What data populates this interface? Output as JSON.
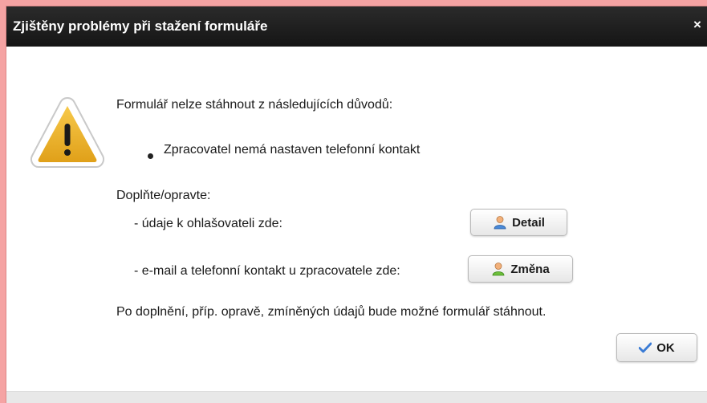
{
  "dialog": {
    "title": "Zjištěny problémy při stažení formuláře",
    "close_glyph": "×",
    "icon": "warning-triangle-icon"
  },
  "message": {
    "intro": "Formulář nelze stáhnout z následujících důvodů:",
    "reasons": [
      "Zpracovatel nemá nastaven telefonní kontakt"
    ],
    "fix_heading": "Doplňte/opravte:",
    "fix_items": [
      {
        "label": "- údaje k ohlašovateli zde:",
        "button_label": "Detail",
        "button_icon": "user-blue-icon"
      },
      {
        "label": "- e-mail a telefonní kontakt u zpracovatele zde:",
        "button_label": "Změna",
        "button_icon": "user-green-icon"
      }
    ],
    "closing": "Po doplnění, příp. opravě, zmíněných údajů bude možné formulář stáhnout."
  },
  "actions": {
    "ok_label": "OK",
    "ok_icon": "checkmark-icon",
    "accent_color": "#3a7bd5"
  }
}
